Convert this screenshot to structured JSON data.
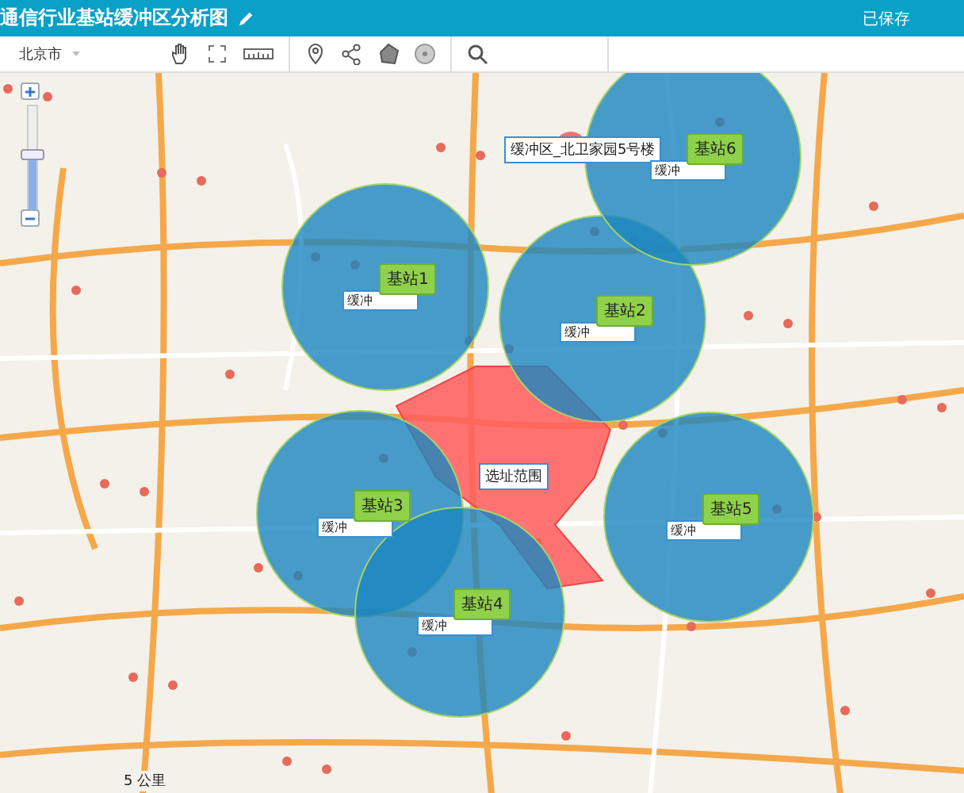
{
  "header": {
    "title": "通信行业基站缓冲区分析图",
    "status": "已保存"
  },
  "toolbar": {
    "city": "北京市"
  },
  "map": {
    "zoom": {
      "level": 0.55
    },
    "point_label": "缓冲区_北卫家园5号楼",
    "site_area_label": "选址范围",
    "stations": [
      {
        "label": "基站1",
        "buffer_label": "缓冲"
      },
      {
        "label": "基站2",
        "buffer_label": "缓冲"
      },
      {
        "label": "基站6",
        "buffer_label": "缓冲"
      },
      {
        "label": "基站3",
        "buffer_label": "缓冲"
      },
      {
        "label": "基站4",
        "buffer_label": "缓冲"
      },
      {
        "label": "基站5",
        "buffer_label": "缓冲"
      }
    ],
    "scale": "5 公里"
  }
}
